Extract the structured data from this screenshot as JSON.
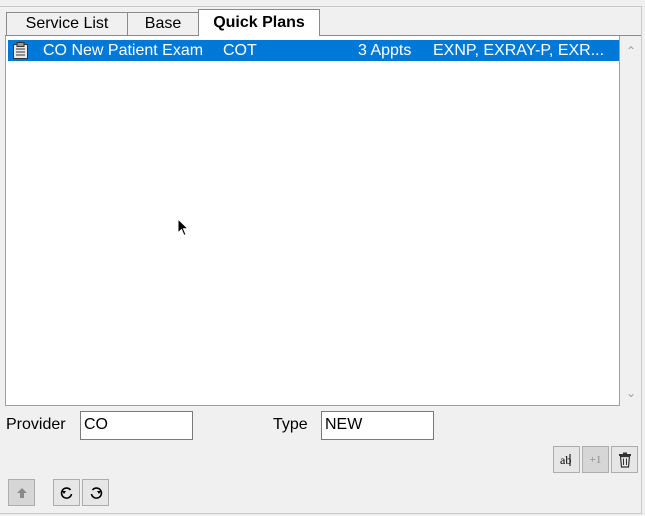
{
  "tabs": [
    {
      "label": "Service List",
      "active": false
    },
    {
      "label": "Base",
      "active": false
    },
    {
      "label": "Quick Plans",
      "active": true
    }
  ],
  "list": {
    "rows": [
      {
        "icon": "clipboard-icon",
        "name": "CO New Patient Exam",
        "provider": "COT",
        "appointments": "3 Appts",
        "codes": "EXNP, EXRAY-P, EXR..."
      }
    ],
    "selected_color": "#0078d7"
  },
  "form": {
    "provider_label": "Provider",
    "provider_value": "CO",
    "type_label": "Type",
    "type_value": "NEW"
  },
  "buttons": {
    "plus_one_label": "+1"
  }
}
